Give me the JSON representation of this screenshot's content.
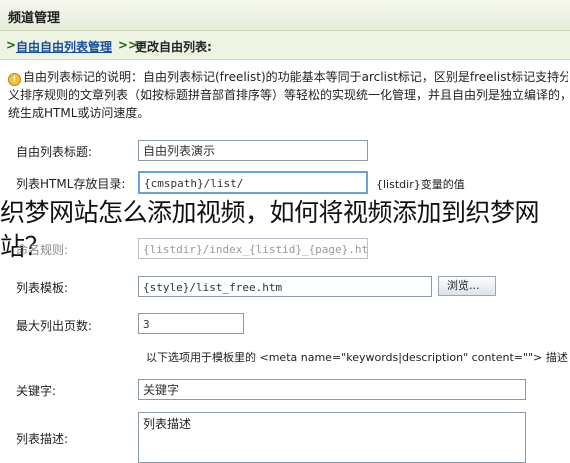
{
  "header": {
    "title": "频道管理"
  },
  "breadcrumb": {
    "prefix": ">",
    "link": "自由自由列表管理",
    "separator": ">>",
    "current": "更改自由列表:"
  },
  "description": {
    "line1": "自由列表标记的说明：自由列表标记(freelist)的功能基本等同于arclist标记，区别是freelist标记支持分页",
    "line2": "义排序规则的文章列表（如按标题拼音部首排序等）等轻松的实现统一化管理，并且自由列是独立编译的，不与",
    "line3": "统生成HTML或访问速度。"
  },
  "form": {
    "title_label": "自由列表标题:",
    "title_value": "自由列表演示",
    "dir_label": "列表HTML存放目录:",
    "dir_value": "{cmspath}/list/",
    "dir_hint": "{listdir}变量的值",
    "naming_label": "命名规则:",
    "naming_value": "{listdir}/index_{listid}_{page}.html",
    "template_label": "列表模板:",
    "template_value": "{style}/list_free.htm",
    "browse_label": "浏览...",
    "maxpages_label": "最大列出页数:",
    "maxpages_value": "3",
    "meta_hint": "以下选项用于模板里的 <meta name=\"keywords|description\" content=\"\"> 描述",
    "keywords_label": "关键字:",
    "keywords_value": "关键字",
    "description_label": "列表描述:",
    "description_value": "列表描述"
  },
  "overlay": {
    "line1": "织梦网站怎么添加视频，如何将视频添加到织梦网",
    "line2": "站？"
  }
}
